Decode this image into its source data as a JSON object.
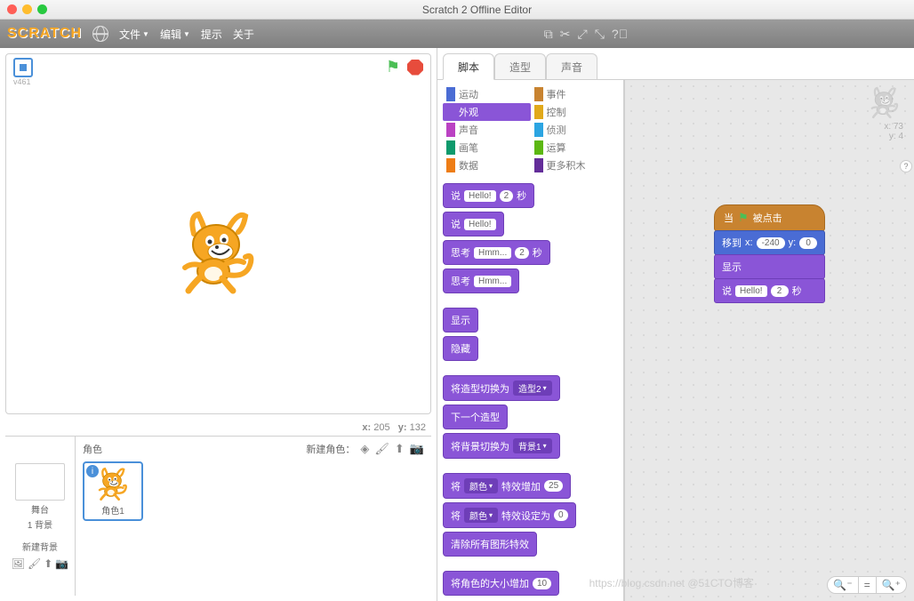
{
  "window": {
    "title": "Scratch 2 Offline Editor"
  },
  "logo": "SCRATCH",
  "menubar": {
    "file": "文件",
    "edit": "编辑",
    "tips": "提示",
    "about": "关于"
  },
  "stage": {
    "version": "v461",
    "coords_label_x": "x:",
    "coords_label_y": "y:",
    "mouse_x": "205",
    "mouse_y": "132"
  },
  "sprite_panel": {
    "stage_label": "舞台",
    "backdrop_count": "1 背景",
    "new_backdrop": "新建背景",
    "sprites_label": "角色",
    "new_sprite": "新建角色：",
    "sprites": [
      {
        "name": "角色1"
      }
    ]
  },
  "tabs": {
    "scripts": "脚本",
    "costumes": "造型",
    "sounds": "声音"
  },
  "categories": {
    "motion": "运动",
    "events": "事件",
    "looks": "外观",
    "control": "控制",
    "sound": "声音",
    "sensing": "侦测",
    "pen": "画笔",
    "operators": "运算",
    "data": "数据",
    "more": "更多积木"
  },
  "palette_blocks": {
    "say": "说",
    "hello": "Hello!",
    "secs": "秒",
    "two": "2",
    "think": "思考",
    "hmm": "Hmm...",
    "show": "显示",
    "hide": "隐藏",
    "switch_costume": "将造型切换为",
    "costume2": "造型2",
    "next_costume": "下一个造型",
    "switch_backdrop": "将背景切换为",
    "backdrop1": "背景1",
    "set_label": "将",
    "color": "颜色",
    "effect_add": "特效增加",
    "twentyfive": "25",
    "effect_set": "特效设定为",
    "zero": "0",
    "clear_fx": "清除所有图形特效",
    "change_size": "将角色的大小增加",
    "ten": "10"
  },
  "script": {
    "hat_when": "当",
    "hat_clicked": "被点击",
    "goto": "移到",
    "x_label": "x:",
    "y_label": "y:",
    "x_val": "-240",
    "y_val": "0",
    "show": "显示",
    "say": "说",
    "hello": "Hello!",
    "two": "2",
    "secs": "秒"
  },
  "sprite_info": {
    "x_label": "x:",
    "x_val": "73",
    "y_label": "y:",
    "y_val": "4"
  },
  "watermark": "https://blog.csdn.net @51CTO博客"
}
